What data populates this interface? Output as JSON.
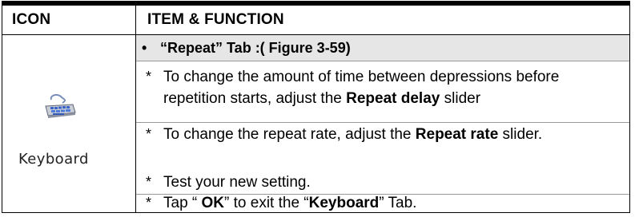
{
  "table": {
    "header_icon": "ICON",
    "header_item": "ITEM & FUNCTION"
  },
  "icon": {
    "name": "keyboard-icon",
    "caption": "Keyboard"
  },
  "section": {
    "bullet": "•",
    "title": "“Repeat” Tab :( Figure 3-59)"
  },
  "items": [
    {
      "star": "*",
      "text_before": "To change the amount of time between depressions before repetition starts, adjust the ",
      "bold": "Repeat delay",
      "text_after": " slider"
    },
    {
      "star": "*",
      "text_before": "To change the repeat rate, adjust the ",
      "bold": "Repeat rate",
      "text_after": " slider."
    },
    {
      "star": "*",
      "text": "Test your new setting."
    },
    {
      "star": "*",
      "text_before": "Tap “ ",
      "bold": "OK",
      "text_middle": "” to exit the “",
      "bold2": "Keyboard",
      "text_after": "” Tab."
    }
  ]
}
